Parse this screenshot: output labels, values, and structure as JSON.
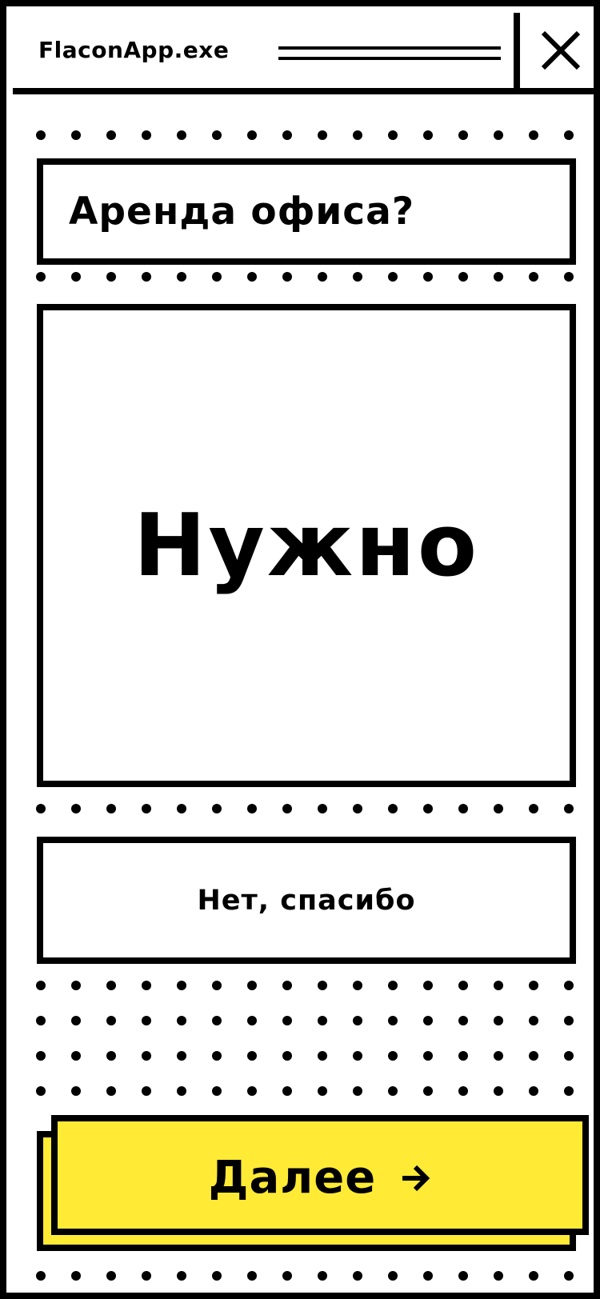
{
  "window": {
    "title": "FlaconApp.exe",
    "close_icon": "close-icon"
  },
  "question": {
    "text": "Аренда офиса?"
  },
  "answer": {
    "text": "Нужно"
  },
  "decline_button": {
    "label": "Нет, спасибо"
  },
  "next_button": {
    "label": "Далее",
    "icon": "arrow-right-icon"
  },
  "colors": {
    "background": "#ffffff",
    "border": "#000000",
    "accent": "#ffea35"
  }
}
